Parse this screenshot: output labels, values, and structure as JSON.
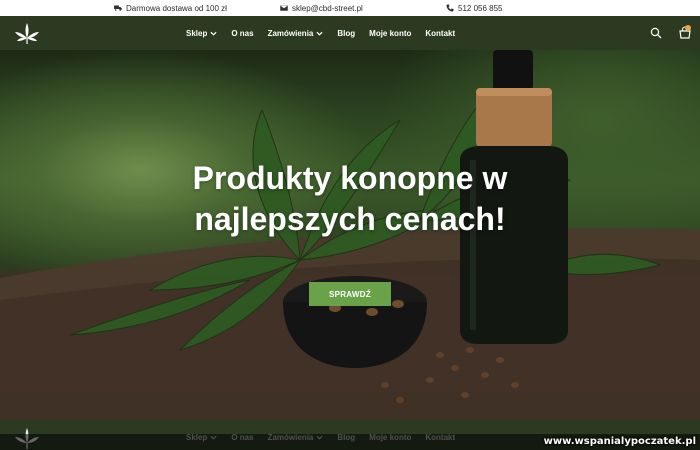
{
  "topbar": {
    "shipping": "Darmowa dostawa od 100 zł",
    "email": "sklep@cbd-street.pl",
    "phone": "512 056 855"
  },
  "nav": {
    "items": [
      {
        "label": "Sklep",
        "dropdown": true
      },
      {
        "label": "O nas",
        "dropdown": false
      },
      {
        "label": "Zamówienia",
        "dropdown": true
      },
      {
        "label": "Blog",
        "dropdown": false
      },
      {
        "label": "Moje konto",
        "dropdown": false
      },
      {
        "label": "Kontakt",
        "dropdown": false
      }
    ],
    "search_icon": "search-icon",
    "cart_icon": "cart-icon"
  },
  "hero": {
    "title_line1": "Produkty konopne w",
    "title_line2": "najlepszych cenach!",
    "button": "SPRAWDŹ"
  },
  "watermark": "www.wspanialypoczatek.pl",
  "colors": {
    "nav_bg": "#2d3a22",
    "button_green": "#6aa24a",
    "text_white": "#ffffff"
  }
}
